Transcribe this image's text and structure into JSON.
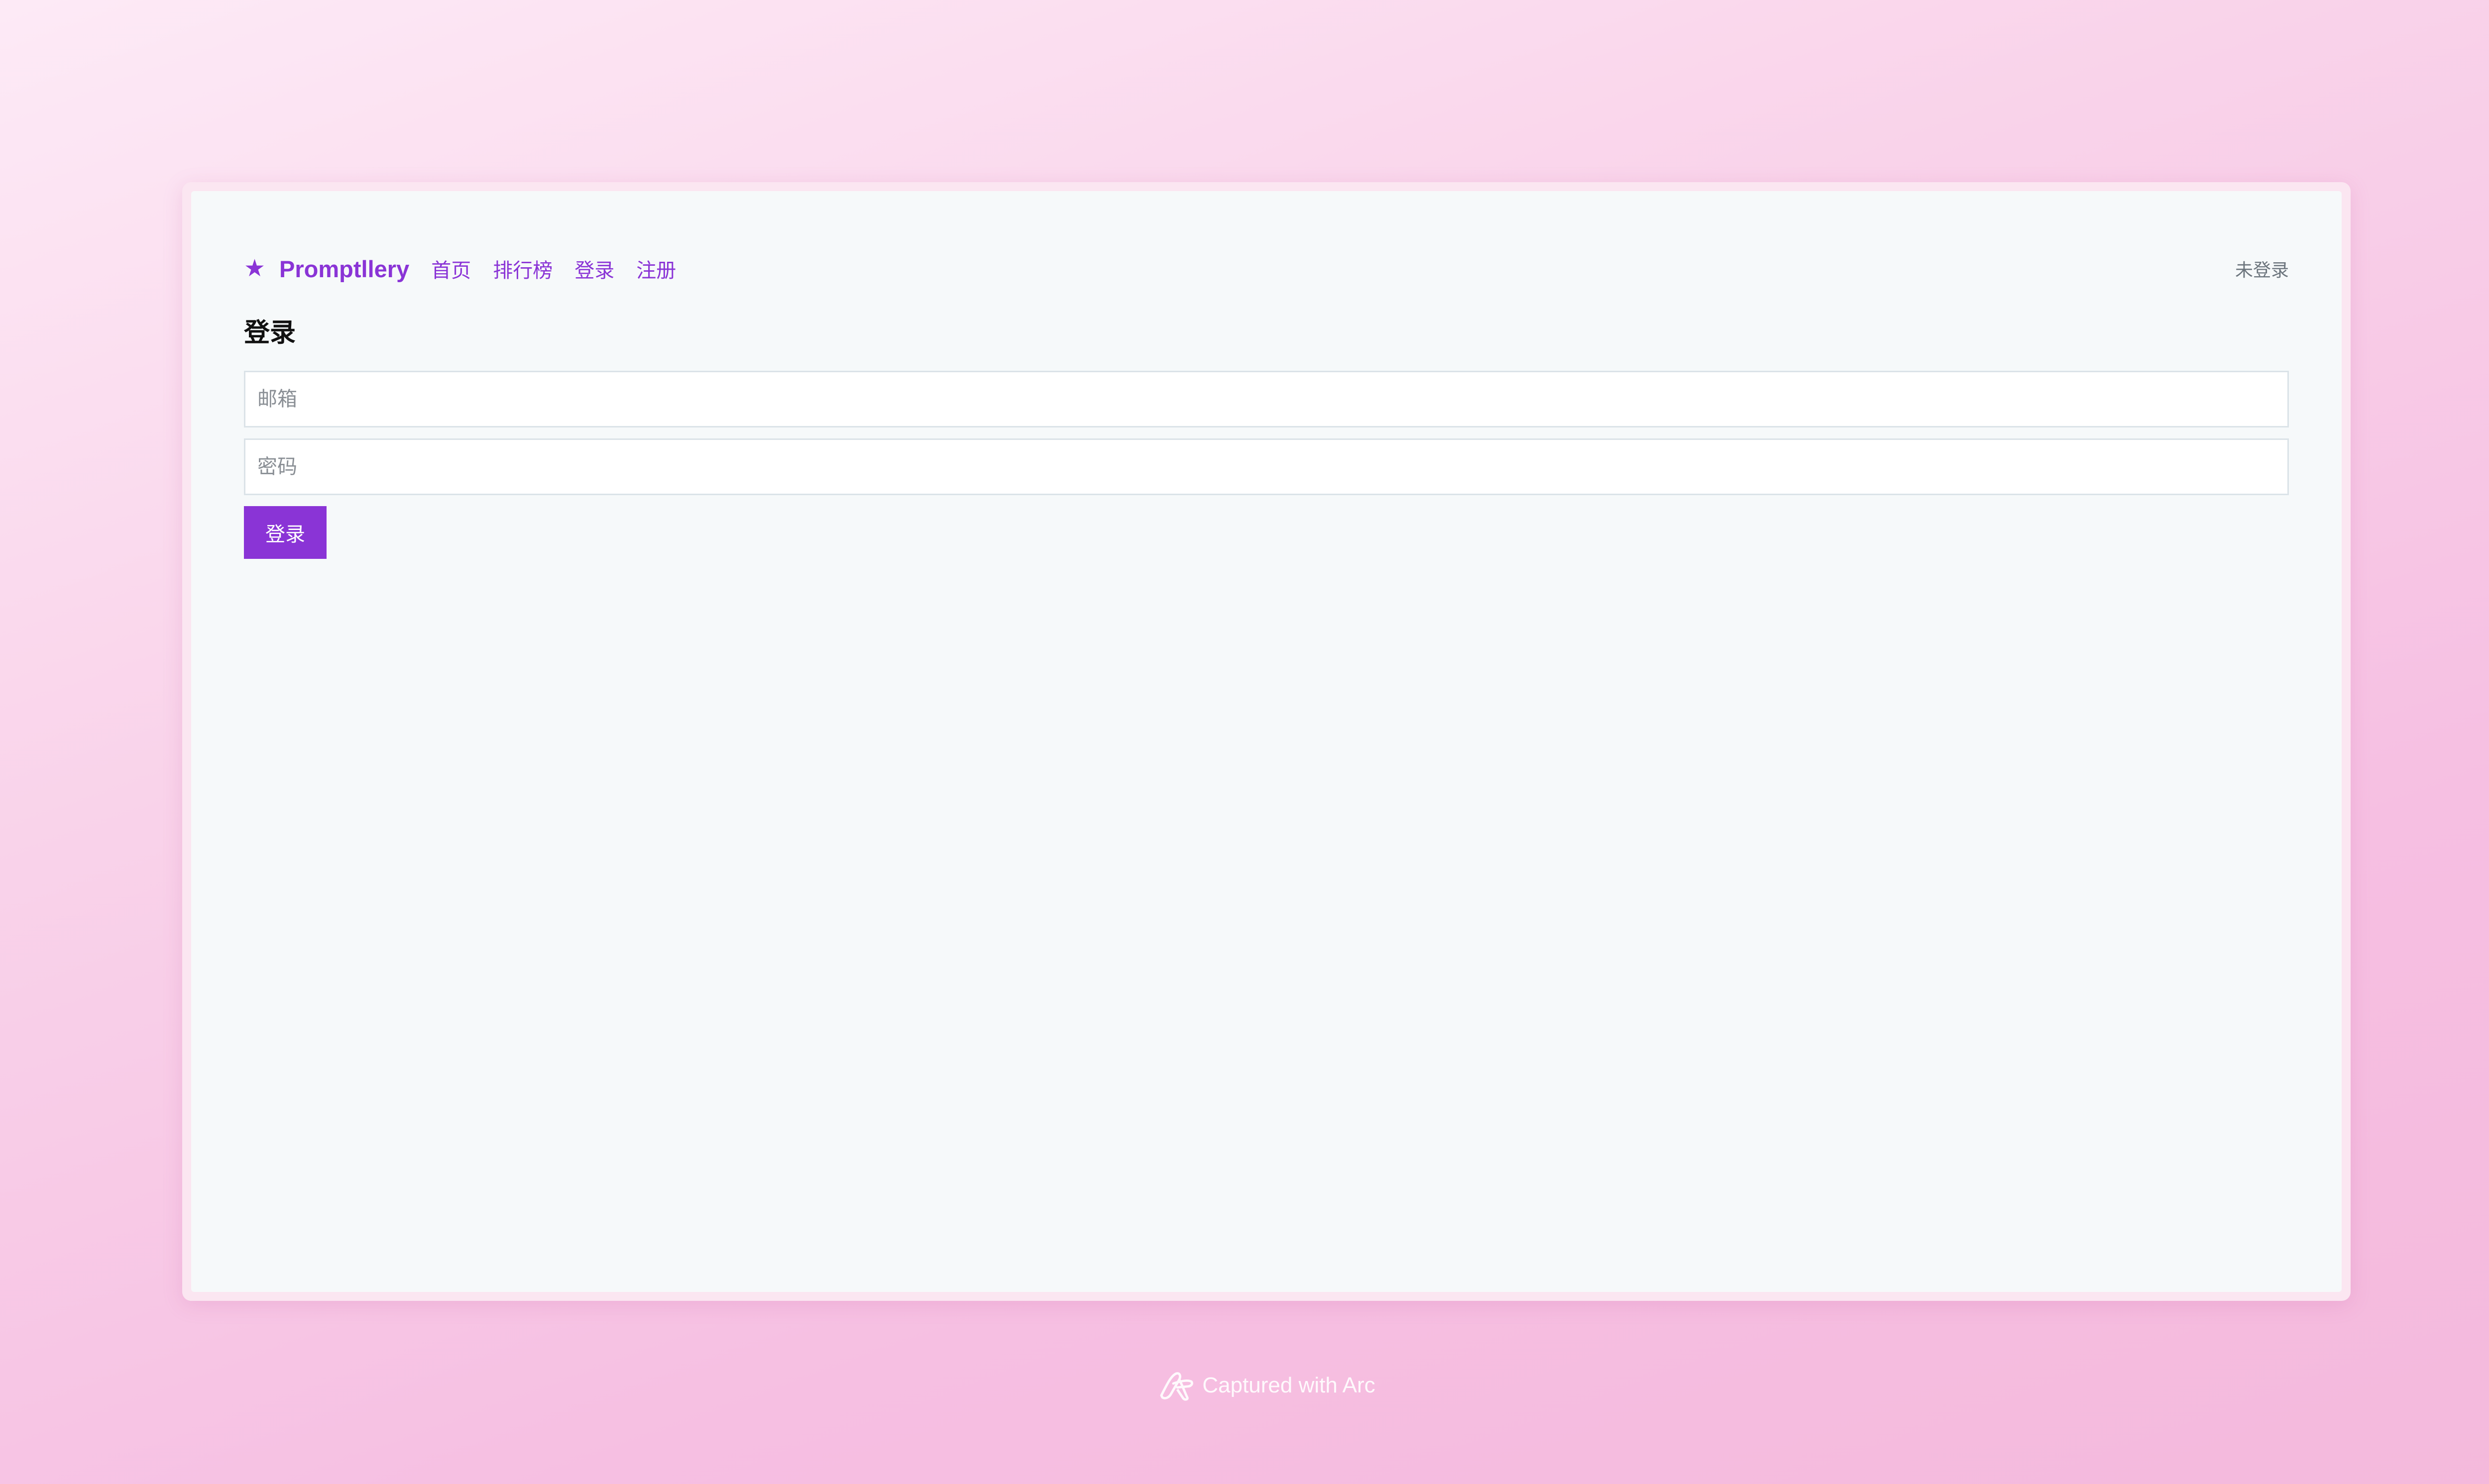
{
  "navbar": {
    "brand_icon": "star-icon",
    "brand_name": "Promptllery",
    "links": [
      "首页",
      "排行榜",
      "登录",
      "注册"
    ],
    "user_status": "未登录"
  },
  "login": {
    "title": "登录",
    "email_placeholder": "邮箱",
    "password_placeholder": "密码",
    "submit_label": "登录"
  },
  "caption": {
    "icon": "arc-logo-icon",
    "text": "Captured with Arc"
  },
  "colors": {
    "accent": "#8a34d6",
    "background_gradient_start": "#fdeaf6",
    "background_gradient_end": "#f4b9dc",
    "page_bg": "#f6f9fa"
  }
}
